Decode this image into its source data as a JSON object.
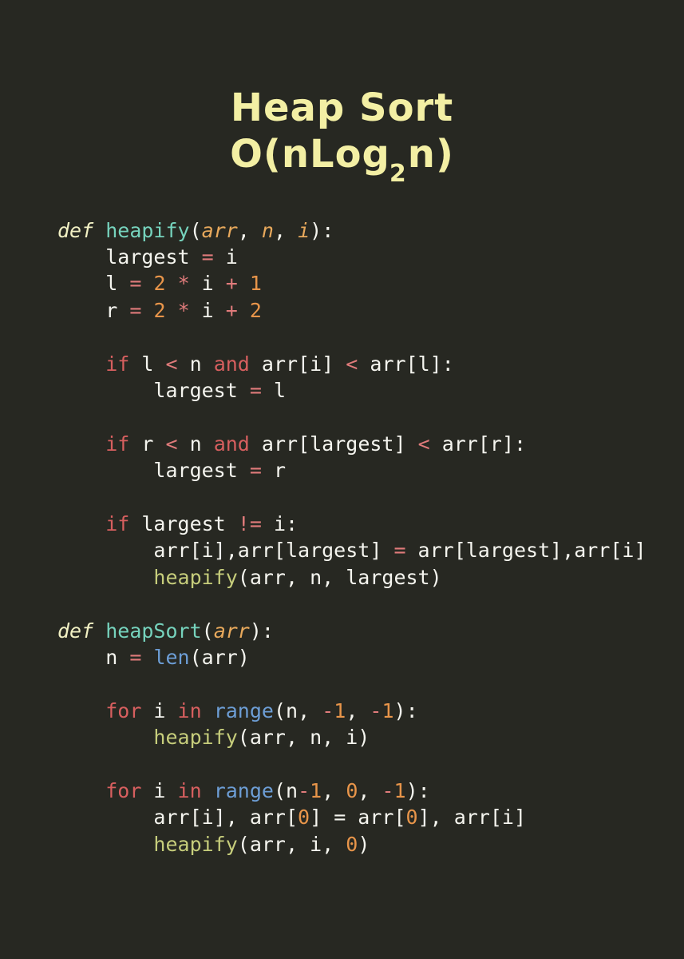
{
  "poster": {
    "background_color": "#272822",
    "title": {
      "line1": "Heap Sort",
      "line2_prefix": "O(nLog",
      "line2_subscript": "2",
      "line2_suffix": "n)",
      "color": "#f3efa4"
    },
    "palette": {
      "background": "#272822",
      "title": "#f3efa4",
      "text": "#f5f5ef",
      "def_keyword": "#f2f1c4",
      "function_name": "#76d3bd",
      "parameter": "#e8a95c",
      "keyword": "#d75f5f",
      "operator": "#e07b7b",
      "number": "#e8954a",
      "builtin": "#6d9ed6",
      "function_call": "#c6cd7b"
    },
    "language": "python",
    "code_lines": [
      {
        "id": "line-1",
        "tokens": [
          {
            "text": "def ",
            "type": "def"
          },
          {
            "text": "heapify",
            "type": "fname"
          },
          {
            "text": "(",
            "type": "plain"
          },
          {
            "text": "arr",
            "type": "param"
          },
          {
            "text": ", ",
            "type": "plain"
          },
          {
            "text": "n",
            "type": "param"
          },
          {
            "text": ", ",
            "type": "plain"
          },
          {
            "text": "i",
            "type": "param"
          },
          {
            "text": "):",
            "type": "plain"
          }
        ]
      },
      {
        "id": "line-2",
        "tokens": [
          {
            "text": "    largest ",
            "type": "plain"
          },
          {
            "text": "=",
            "type": "op"
          },
          {
            "text": " i",
            "type": "plain"
          }
        ]
      },
      {
        "id": "line-3",
        "tokens": [
          {
            "text": "    l ",
            "type": "plain"
          },
          {
            "text": "=",
            "type": "op"
          },
          {
            "text": " ",
            "type": "plain"
          },
          {
            "text": "2",
            "type": "num"
          },
          {
            "text": " ",
            "type": "plain"
          },
          {
            "text": "*",
            "type": "op"
          },
          {
            "text": " i ",
            "type": "plain"
          },
          {
            "text": "+",
            "type": "op"
          },
          {
            "text": " ",
            "type": "plain"
          },
          {
            "text": "1",
            "type": "num"
          }
        ]
      },
      {
        "id": "line-4",
        "tokens": [
          {
            "text": "    r ",
            "type": "plain"
          },
          {
            "text": "=",
            "type": "op"
          },
          {
            "text": " ",
            "type": "plain"
          },
          {
            "text": "2",
            "type": "num"
          },
          {
            "text": " ",
            "type": "plain"
          },
          {
            "text": "*",
            "type": "op"
          },
          {
            "text": " i ",
            "type": "plain"
          },
          {
            "text": "+",
            "type": "op"
          },
          {
            "text": " ",
            "type": "plain"
          },
          {
            "text": "2",
            "type": "num"
          }
        ]
      },
      {
        "id": "line-5",
        "blank": true,
        "tokens": []
      },
      {
        "id": "line-6",
        "tokens": [
          {
            "text": "    ",
            "type": "plain"
          },
          {
            "text": "if",
            "type": "kw"
          },
          {
            "text": " l ",
            "type": "plain"
          },
          {
            "text": "<",
            "type": "op"
          },
          {
            "text": " n ",
            "type": "plain"
          },
          {
            "text": "and",
            "type": "kw"
          },
          {
            "text": " arr[i] ",
            "type": "plain"
          },
          {
            "text": "<",
            "type": "op"
          },
          {
            "text": " arr[l]:",
            "type": "plain"
          }
        ]
      },
      {
        "id": "line-7",
        "tokens": [
          {
            "text": "        largest ",
            "type": "plain"
          },
          {
            "text": "=",
            "type": "op"
          },
          {
            "text": " l",
            "type": "plain"
          }
        ]
      },
      {
        "id": "line-8",
        "blank": true,
        "tokens": []
      },
      {
        "id": "line-9",
        "tokens": [
          {
            "text": "    ",
            "type": "plain"
          },
          {
            "text": "if",
            "type": "kw"
          },
          {
            "text": " r ",
            "type": "plain"
          },
          {
            "text": "<",
            "type": "op"
          },
          {
            "text": " n ",
            "type": "plain"
          },
          {
            "text": "and",
            "type": "kw"
          },
          {
            "text": " arr[largest] ",
            "type": "plain"
          },
          {
            "text": "<",
            "type": "op"
          },
          {
            "text": " arr[r]:",
            "type": "plain"
          }
        ]
      },
      {
        "id": "line-10",
        "tokens": [
          {
            "text": "        largest ",
            "type": "plain"
          },
          {
            "text": "=",
            "type": "op"
          },
          {
            "text": " r",
            "type": "plain"
          }
        ]
      },
      {
        "id": "line-11",
        "blank": true,
        "tokens": []
      },
      {
        "id": "line-12",
        "tokens": [
          {
            "text": "    ",
            "type": "plain"
          },
          {
            "text": "if",
            "type": "kw"
          },
          {
            "text": " largest ",
            "type": "plain"
          },
          {
            "text": "!=",
            "type": "op"
          },
          {
            "text": " i:",
            "type": "plain"
          }
        ]
      },
      {
        "id": "line-13",
        "tokens": [
          {
            "text": "        arr[i],arr[largest] ",
            "type": "plain"
          },
          {
            "text": "=",
            "type": "op"
          },
          {
            "text": " arr[largest],arr[i]",
            "type": "plain"
          }
        ]
      },
      {
        "id": "line-14",
        "tokens": [
          {
            "text": "        ",
            "type": "plain"
          },
          {
            "text": "heapify",
            "type": "call"
          },
          {
            "text": "(arr, n, largest)",
            "type": "plain"
          }
        ]
      },
      {
        "id": "line-15",
        "blank": true,
        "tokens": []
      },
      {
        "id": "line-16",
        "tokens": [
          {
            "text": "def ",
            "type": "def"
          },
          {
            "text": "heapSort",
            "type": "fname"
          },
          {
            "text": "(",
            "type": "plain"
          },
          {
            "text": "arr",
            "type": "param"
          },
          {
            "text": "):",
            "type": "plain"
          }
        ]
      },
      {
        "id": "line-17",
        "tokens": [
          {
            "text": "    n ",
            "type": "plain"
          },
          {
            "text": "=",
            "type": "op"
          },
          {
            "text": " ",
            "type": "plain"
          },
          {
            "text": "len",
            "type": "builtin"
          },
          {
            "text": "(arr)",
            "type": "plain"
          }
        ]
      },
      {
        "id": "line-18",
        "blank": true,
        "tokens": []
      },
      {
        "id": "line-19",
        "tokens": [
          {
            "text": "    ",
            "type": "plain"
          },
          {
            "text": "for",
            "type": "kw"
          },
          {
            "text": " i ",
            "type": "plain"
          },
          {
            "text": "in",
            "type": "kw"
          },
          {
            "text": " ",
            "type": "plain"
          },
          {
            "text": "range",
            "type": "builtin"
          },
          {
            "text": "(n, ",
            "type": "plain"
          },
          {
            "text": "-",
            "type": "op"
          },
          {
            "text": "1",
            "type": "num"
          },
          {
            "text": ", ",
            "type": "plain"
          },
          {
            "text": "-",
            "type": "op"
          },
          {
            "text": "1",
            "type": "num"
          },
          {
            "text": "):",
            "type": "plain"
          }
        ]
      },
      {
        "id": "line-20",
        "tokens": [
          {
            "text": "        ",
            "type": "plain"
          },
          {
            "text": "heapify",
            "type": "call"
          },
          {
            "text": "(arr, n, i)",
            "type": "plain"
          }
        ]
      },
      {
        "id": "line-21",
        "blank": true,
        "tokens": []
      },
      {
        "id": "line-22",
        "tokens": [
          {
            "text": "    ",
            "type": "plain"
          },
          {
            "text": "for",
            "type": "kw"
          },
          {
            "text": " i ",
            "type": "plain"
          },
          {
            "text": "in",
            "type": "kw"
          },
          {
            "text": " ",
            "type": "plain"
          },
          {
            "text": "range",
            "type": "builtin"
          },
          {
            "text": "(n",
            "type": "plain"
          },
          {
            "text": "-",
            "type": "op"
          },
          {
            "text": "1",
            "type": "num"
          },
          {
            "text": ", ",
            "type": "plain"
          },
          {
            "text": "0",
            "type": "num"
          },
          {
            "text": ", ",
            "type": "plain"
          },
          {
            "text": "-",
            "type": "op"
          },
          {
            "text": "1",
            "type": "num"
          },
          {
            "text": "):",
            "type": "plain"
          }
        ]
      },
      {
        "id": "line-23",
        "tokens": [
          {
            "text": "        arr[i], arr[",
            "type": "plain"
          },
          {
            "text": "0",
            "type": "num"
          },
          {
            "text": "] = arr[",
            "type": "plain"
          },
          {
            "text": "0",
            "type": "num"
          },
          {
            "text": "], arr[i]",
            "type": "plain"
          }
        ]
      },
      {
        "id": "line-24",
        "tokens": [
          {
            "text": "        ",
            "type": "plain"
          },
          {
            "text": "heapify",
            "type": "call"
          },
          {
            "text": "(arr, i, ",
            "type": "plain"
          },
          {
            "text": "0",
            "type": "num"
          },
          {
            "text": ")",
            "type": "plain"
          }
        ]
      }
    ]
  }
}
